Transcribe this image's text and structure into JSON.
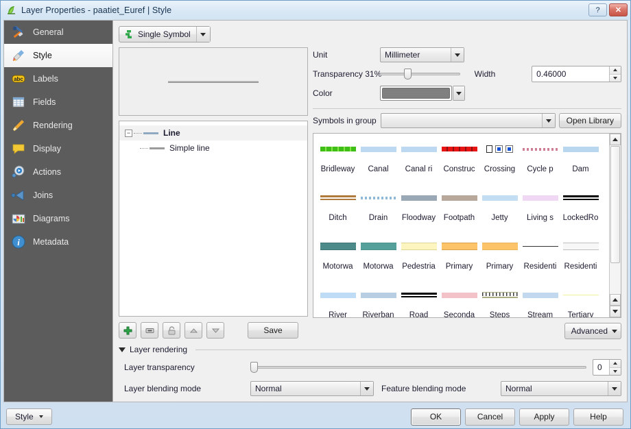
{
  "window": {
    "title": "Layer Properties - paatiet_Euref | Style",
    "app_icon": "qgis-icon",
    "help_button": "?",
    "close_button": "✕"
  },
  "sidebar": {
    "items": [
      {
        "label": "General",
        "icon": "tools-icon",
        "selected": false
      },
      {
        "label": "Style",
        "icon": "brush-icon",
        "selected": true
      },
      {
        "label": "Labels",
        "icon": "abc-icon",
        "selected": false
      },
      {
        "label": "Fields",
        "icon": "table-icon",
        "selected": false
      },
      {
        "label": "Rendering",
        "icon": "broom-icon",
        "selected": false
      },
      {
        "label": "Display",
        "icon": "speech-icon",
        "selected": false
      },
      {
        "label": "Actions",
        "icon": "gear-play-icon",
        "selected": false
      },
      {
        "label": "Joins",
        "icon": "join-arrow-icon",
        "selected": false
      },
      {
        "label": "Diagrams",
        "icon": "chart-icon",
        "selected": false
      },
      {
        "label": "Metadata",
        "icon": "info-icon",
        "selected": false
      }
    ]
  },
  "renderer": {
    "label": "Single Symbol",
    "icon": "single-symbol-icon"
  },
  "symbol_tree": {
    "root": {
      "label": "Line",
      "expander": "−"
    },
    "child": {
      "label": "Simple line"
    }
  },
  "symbol_tools": {
    "add": "add-symbol-layer",
    "remove": "remove-symbol-layer",
    "lock": "lock-layer-colors",
    "up": "move-up",
    "down": "move-down",
    "save_label": "Save"
  },
  "properties": {
    "unit_label": "Unit",
    "unit_value": "Millimeter",
    "transparency_label": "Transparency 31%",
    "transparency_percent": 31,
    "width_label": "Width",
    "width_value": "0.46000",
    "color_label": "Color",
    "color_value": "#808080",
    "symbols_in_group_label": "Symbols in group",
    "symbols_in_group_value": "",
    "open_library_label": "Open Library"
  },
  "symbol_library": {
    "items": [
      {
        "name": "Bridleway",
        "style": "dashed",
        "color": "#3fbf16",
        "color2": "#86e34a"
      },
      {
        "name": "Canal",
        "style": "band",
        "color": "#bdd9f2"
      },
      {
        "name": "Canal ri",
        "style": "band",
        "color": "#bdd9f2"
      },
      {
        "name": "Construc",
        "style": "dashed",
        "color": "#e81414",
        "color2": "#8d1111"
      },
      {
        "name": "Crossing",
        "style": "markers",
        "color": "#1552d6"
      },
      {
        "name": "Cycle p",
        "style": "dotted",
        "color": "#cf7f95"
      },
      {
        "name": "Dam",
        "style": "band",
        "color": "#b8d6ee"
      },
      {
        "name": "Ditch",
        "style": "double",
        "color": "#b07a3c",
        "color2": "#7d7d7d"
      },
      {
        "name": "Drain",
        "style": "dotted",
        "color": "#8fb9d8"
      },
      {
        "name": "Floodway",
        "style": "band",
        "color": "#9aa7b5"
      },
      {
        "name": "Footpath",
        "style": "band",
        "color": "#b8a89b"
      },
      {
        "name": "Jetty",
        "style": "band",
        "color": "#c3ddf2"
      },
      {
        "name": "Living s",
        "style": "band",
        "color": "#f0d8f4"
      },
      {
        "name": "LockedRo",
        "style": "double",
        "color": "#000000"
      },
      {
        "name": "Motorwa",
        "style": "casing",
        "color": "#4d8a8a",
        "color2": "#3e7272"
      },
      {
        "name": "Motorwa",
        "style": "casing",
        "color": "#56a09c",
        "color2": "#49908c"
      },
      {
        "name": "Pedestria",
        "style": "casing",
        "color": "#fcf5c0",
        "color2": "#ddd591"
      },
      {
        "name": "Primary",
        "style": "casing",
        "color": "#fcc368",
        "color2": "#d9a14a"
      },
      {
        "name": "Primary",
        "style": "casing",
        "color": "#fcc368",
        "color2": "#e8b45a"
      },
      {
        "name": "Residenti",
        "style": "thin",
        "color": "#333333"
      },
      {
        "name": "Residenti",
        "style": "casing",
        "color": "#f7f7f7",
        "color2": "#bdbdbd"
      },
      {
        "name": "River",
        "style": "band",
        "color": "#bedcf5"
      },
      {
        "name": "Riverban",
        "style": "band",
        "color": "#b7cee2"
      },
      {
        "name": "Road",
        "style": "double",
        "color": "#000000"
      },
      {
        "name": "Seconda",
        "style": "band",
        "color": "#f2c2c8"
      },
      {
        "name": "Steps",
        "style": "steps",
        "color": "#adad84"
      },
      {
        "name": "Stream",
        "style": "band",
        "color": "#c2d8ee"
      },
      {
        "name": "Tertiary",
        "style": "thin",
        "color": "#f2f29a"
      }
    ]
  },
  "advanced": {
    "label": "Advanced"
  },
  "layer_rendering": {
    "section_label": "Layer rendering",
    "transparency_label": "Layer transparency",
    "transparency_value": "0",
    "blending_label": "Layer blending mode",
    "blending_value": "Normal",
    "feature_blending_label": "Feature blending mode",
    "feature_blending_value": "Normal"
  },
  "footer": {
    "style_label": "Style",
    "ok_label": "OK",
    "cancel_label": "Cancel",
    "apply_label": "Apply",
    "help_label": "Help"
  }
}
